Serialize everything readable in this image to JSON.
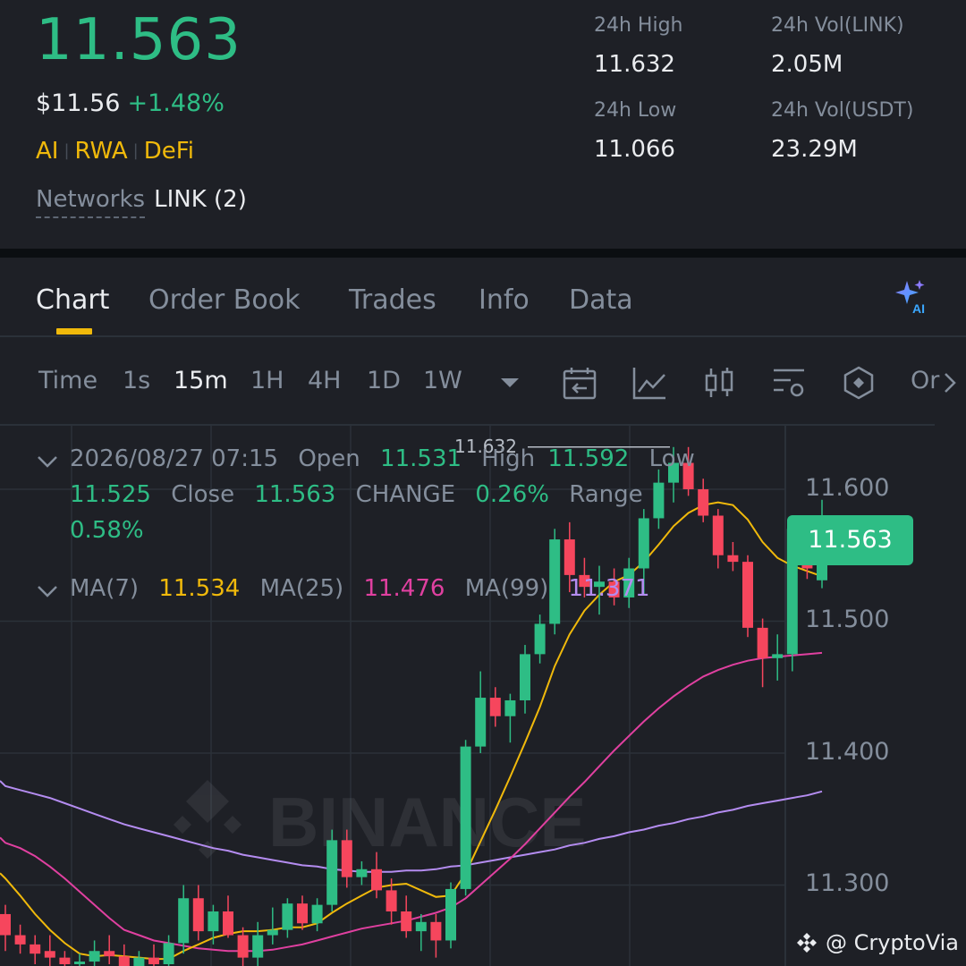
{
  "header": {
    "price": "11.563",
    "usd_price": "$11.56",
    "change_pct": "+1.48%",
    "tags": [
      "AI",
      "RWA",
      "DeFi"
    ],
    "networks_label": "Networks",
    "networks_value": "LINK (2)"
  },
  "stats": {
    "high_label": "24h High",
    "high_value": "11.632",
    "low_label": "24h Low",
    "low_value": "11.066",
    "vol_link_label": "24h Vol(LINK)",
    "vol_link_value": "2.05M",
    "vol_usdt_label": "24h Vol(USDT)",
    "vol_usdt_value": "23.29M"
  },
  "tabs": [
    "Chart",
    "Order Book",
    "Trades",
    "Info",
    "Data"
  ],
  "active_tab": "Chart",
  "toolbar": {
    "time_label": "Time",
    "intervals": [
      "1s",
      "15m",
      "1H",
      "4H",
      "1D",
      "1W"
    ],
    "active_interval": "15m",
    "overflow_label": "Or"
  },
  "ohlc": {
    "datetime": "2026/08/27 07:15",
    "open_label": "Open",
    "open": "11.531",
    "high_label": "High",
    "high": "11.592",
    "low_label": "Low",
    "low": "11.525",
    "close_label": "Close",
    "close": "11.563",
    "change_label": "CHANGE",
    "change": "0.26%",
    "range_label": "Range",
    "range": "0.58%"
  },
  "ma": {
    "ma7_label": "MA(7)",
    "ma7": "11.534",
    "ma25_label": "MA(25)",
    "ma25": "11.476",
    "ma99_label": "MA(99)",
    "ma99": "11.371"
  },
  "chart_data": {
    "type": "candlestick",
    "y_ticks": [
      "11.600",
      "11.500",
      "11.400",
      "11.300"
    ],
    "ylim": [
      11.245,
      11.66
    ],
    "current_price": "11.563",
    "high_marker": "11.632",
    "watermark": "BINANCE",
    "colors": {
      "up": "#2ebd85",
      "down": "#f6465d",
      "ma7": "#f0b90b",
      "ma25": "#e040a0",
      "ma99": "#b48cf0"
    },
    "candles": [
      {
        "o": 11.278,
        "h": 11.285,
        "l": 11.25,
        "c": 11.262
      },
      {
        "o": 11.262,
        "h": 11.27,
        "l": 11.248,
        "c": 11.255
      },
      {
        "o": 11.255,
        "h": 11.262,
        "l": 11.24,
        "c": 11.248
      },
      {
        "o": 11.25,
        "h": 11.262,
        "l": 11.238,
        "c": 11.245
      },
      {
        "o": 11.245,
        "h": 11.25,
        "l": 11.232,
        "c": 11.24
      },
      {
        "o": 11.24,
        "h": 11.248,
        "l": 11.23,
        "c": 11.242
      },
      {
        "o": 11.242,
        "h": 11.258,
        "l": 11.235,
        "c": 11.25
      },
      {
        "o": 11.25,
        "h": 11.262,
        "l": 11.24,
        "c": 11.246
      },
      {
        "o": 11.246,
        "h": 11.255,
        "l": 11.232,
        "c": 11.238
      },
      {
        "o": 11.238,
        "h": 11.25,
        "l": 11.228,
        "c": 11.245
      },
      {
        "o": 11.245,
        "h": 11.255,
        "l": 11.235,
        "c": 11.24
      },
      {
        "o": 11.24,
        "h": 11.262,
        "l": 11.233,
        "c": 11.256
      },
      {
        "o": 11.256,
        "h": 11.3,
        "l": 11.248,
        "c": 11.29
      },
      {
        "o": 11.29,
        "h": 11.3,
        "l": 11.258,
        "c": 11.265
      },
      {
        "o": 11.265,
        "h": 11.285,
        "l": 11.255,
        "c": 11.28
      },
      {
        "o": 11.28,
        "h": 11.292,
        "l": 11.26,
        "c": 11.262
      },
      {
        "o": 11.262,
        "h": 11.268,
        "l": 11.238,
        "c": 11.245
      },
      {
        "o": 11.245,
        "h": 11.272,
        "l": 11.238,
        "c": 11.262
      },
      {
        "o": 11.262,
        "h": 11.283,
        "l": 11.255,
        "c": 11.266
      },
      {
        "o": 11.266,
        "h": 11.29,
        "l": 11.26,
        "c": 11.286
      },
      {
        "o": 11.286,
        "h": 11.292,
        "l": 11.266,
        "c": 11.271
      },
      {
        "o": 11.271,
        "h": 11.29,
        "l": 11.265,
        "c": 11.285
      },
      {
        "o": 11.285,
        "h": 11.342,
        "l": 11.28,
        "c": 11.334
      },
      {
        "o": 11.334,
        "h": 11.342,
        "l": 11.298,
        "c": 11.306
      },
      {
        "o": 11.306,
        "h": 11.318,
        "l": 11.3,
        "c": 11.312
      },
      {
        "o": 11.312,
        "h": 11.325,
        "l": 11.29,
        "c": 11.296
      },
      {
        "o": 11.296,
        "h": 11.305,
        "l": 11.27,
        "c": 11.28
      },
      {
        "o": 11.28,
        "h": 11.292,
        "l": 11.26,
        "c": 11.265
      },
      {
        "o": 11.265,
        "h": 11.278,
        "l": 11.25,
        "c": 11.272
      },
      {
        "o": 11.272,
        "h": 11.278,
        "l": 11.245,
        "c": 11.258
      },
      {
        "o": 11.258,
        "h": 11.302,
        "l": 11.252,
        "c": 11.297
      },
      {
        "o": 11.297,
        "h": 11.41,
        "l": 11.292,
        "c": 11.405
      },
      {
        "o": 11.405,
        "h": 11.462,
        "l": 11.4,
        "c": 11.442
      },
      {
        "o": 11.442,
        "h": 11.45,
        "l": 11.42,
        "c": 11.428
      },
      {
        "o": 11.428,
        "h": 11.445,
        "l": 11.408,
        "c": 11.44
      },
      {
        "o": 11.44,
        "h": 11.482,
        "l": 11.43,
        "c": 11.475
      },
      {
        "o": 11.475,
        "h": 11.505,
        "l": 11.468,
        "c": 11.498
      },
      {
        "o": 11.498,
        "h": 11.57,
        "l": 11.49,
        "c": 11.562
      },
      {
        "o": 11.562,
        "h": 11.575,
        "l": 11.522,
        "c": 11.535
      },
      {
        "o": 11.535,
        "h": 11.548,
        "l": 11.518,
        "c": 11.526
      },
      {
        "o": 11.526,
        "h": 11.542,
        "l": 11.505,
        "c": 11.53
      },
      {
        "o": 11.53,
        "h": 11.54,
        "l": 11.512,
        "c": 11.518
      },
      {
        "o": 11.518,
        "h": 11.548,
        "l": 11.51,
        "c": 11.54
      },
      {
        "o": 11.54,
        "h": 11.585,
        "l": 11.52,
        "c": 11.578
      },
      {
        "o": 11.578,
        "h": 11.615,
        "l": 11.57,
        "c": 11.605
      },
      {
        "o": 11.605,
        "h": 11.632,
        "l": 11.59,
        "c": 11.62
      },
      {
        "o": 11.62,
        "h": 11.632,
        "l": 11.595,
        "c": 11.6
      },
      {
        "o": 11.6,
        "h": 11.608,
        "l": 11.575,
        "c": 11.58
      },
      {
        "o": 11.58,
        "h": 11.585,
        "l": 11.54,
        "c": 11.55
      },
      {
        "o": 11.55,
        "h": 11.56,
        "l": 11.538,
        "c": 11.545
      },
      {
        "o": 11.545,
        "h": 11.55,
        "l": 11.488,
        "c": 11.495
      },
      {
        "o": 11.495,
        "h": 11.502,
        "l": 11.45,
        "c": 11.472
      },
      {
        "o": 11.472,
        "h": 11.49,
        "l": 11.455,
        "c": 11.475
      },
      {
        "o": 11.475,
        "h": 11.58,
        "l": 11.462,
        "c": 11.57
      },
      {
        "o": 11.57,
        "h": 11.578,
        "l": 11.532,
        "c": 11.54
      },
      {
        "o": 11.531,
        "h": 11.592,
        "l": 11.525,
        "c": 11.563
      }
    ],
    "ma7_values": [
      11.305,
      11.292,
      11.278,
      11.266,
      11.256,
      11.248,
      11.246,
      11.247,
      11.246,
      11.245,
      11.244,
      11.244,
      11.25,
      11.255,
      11.26,
      11.263,
      11.265,
      11.265,
      11.266,
      11.268,
      11.268,
      11.271,
      11.279,
      11.286,
      11.292,
      11.298,
      11.3,
      11.301,
      11.296,
      11.291,
      11.292,
      11.309,
      11.333,
      11.357,
      11.382,
      11.408,
      11.435,
      11.466,
      11.49,
      11.508,
      11.52,
      11.53,
      11.535,
      11.545,
      11.558,
      11.572,
      11.582,
      11.588,
      11.59,
      11.588,
      11.577,
      11.56,
      11.548,
      11.542,
      11.538,
      11.534
    ],
    "ma25_values": [
      11.332,
      11.328,
      11.322,
      11.314,
      11.305,
      11.295,
      11.285,
      11.275,
      11.266,
      11.262,
      11.258,
      11.256,
      11.254,
      11.252,
      11.251,
      11.25,
      11.25,
      11.25,
      11.251,
      11.253,
      11.255,
      11.258,
      11.261,
      11.264,
      11.267,
      11.269,
      11.271,
      11.273,
      11.276,
      11.279,
      11.283,
      11.29,
      11.3,
      11.31,
      11.32,
      11.331,
      11.343,
      11.355,
      11.367,
      11.378,
      11.39,
      11.402,
      11.413,
      11.424,
      11.434,
      11.443,
      11.451,
      11.458,
      11.463,
      11.467,
      11.47,
      11.472,
      11.473,
      11.474,
      11.475,
      11.476
    ],
    "ma99_values": [
      11.375,
      11.372,
      11.369,
      11.366,
      11.362,
      11.358,
      11.354,
      11.35,
      11.346,
      11.343,
      11.34,
      11.337,
      11.334,
      11.331,
      11.328,
      11.326,
      11.323,
      11.321,
      11.319,
      11.317,
      11.315,
      11.314,
      11.312,
      11.311,
      11.31,
      11.31,
      11.31,
      11.311,
      11.311,
      11.312,
      11.314,
      11.315,
      11.317,
      11.319,
      11.321,
      11.323,
      11.325,
      11.327,
      11.33,
      11.332,
      11.335,
      11.337,
      11.34,
      11.342,
      11.345,
      11.347,
      11.35,
      11.352,
      11.355,
      11.357,
      11.36,
      11.362,
      11.364,
      11.366,
      11.368,
      11.371
    ]
  },
  "credit": "@ CryptoVia"
}
